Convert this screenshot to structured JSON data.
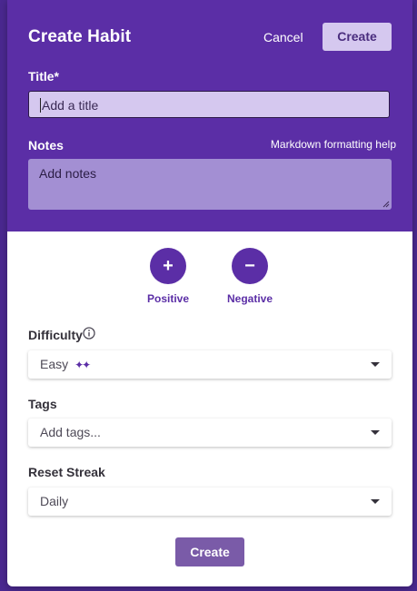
{
  "modal": {
    "title": "Create Habit",
    "cancel_label": "Cancel",
    "create_label": "Create"
  },
  "form": {
    "title_label": "Title*",
    "title_placeholder": "Add a title",
    "notes_label": "Notes",
    "markdown_help": "Markdown formatting help",
    "notes_placeholder": "Add notes"
  },
  "habit_type": {
    "positive_label": "Positive",
    "negative_label": "Negative",
    "positive_symbol": "+",
    "negative_symbol": "−"
  },
  "difficulty": {
    "label": "Difficulty",
    "value": "Easy",
    "sparkle": "✦✦"
  },
  "tags": {
    "label": "Tags",
    "placeholder": "Add tags..."
  },
  "reset_streak": {
    "label": "Reset Streak",
    "value": "Daily"
  },
  "footer": {
    "create_label": "Create"
  },
  "colors": {
    "header_bg": "#5b2ea6",
    "accent": "#5b2ea6",
    "input_bg": "#d5c8ef",
    "notes_bg": "#a38fd3"
  }
}
